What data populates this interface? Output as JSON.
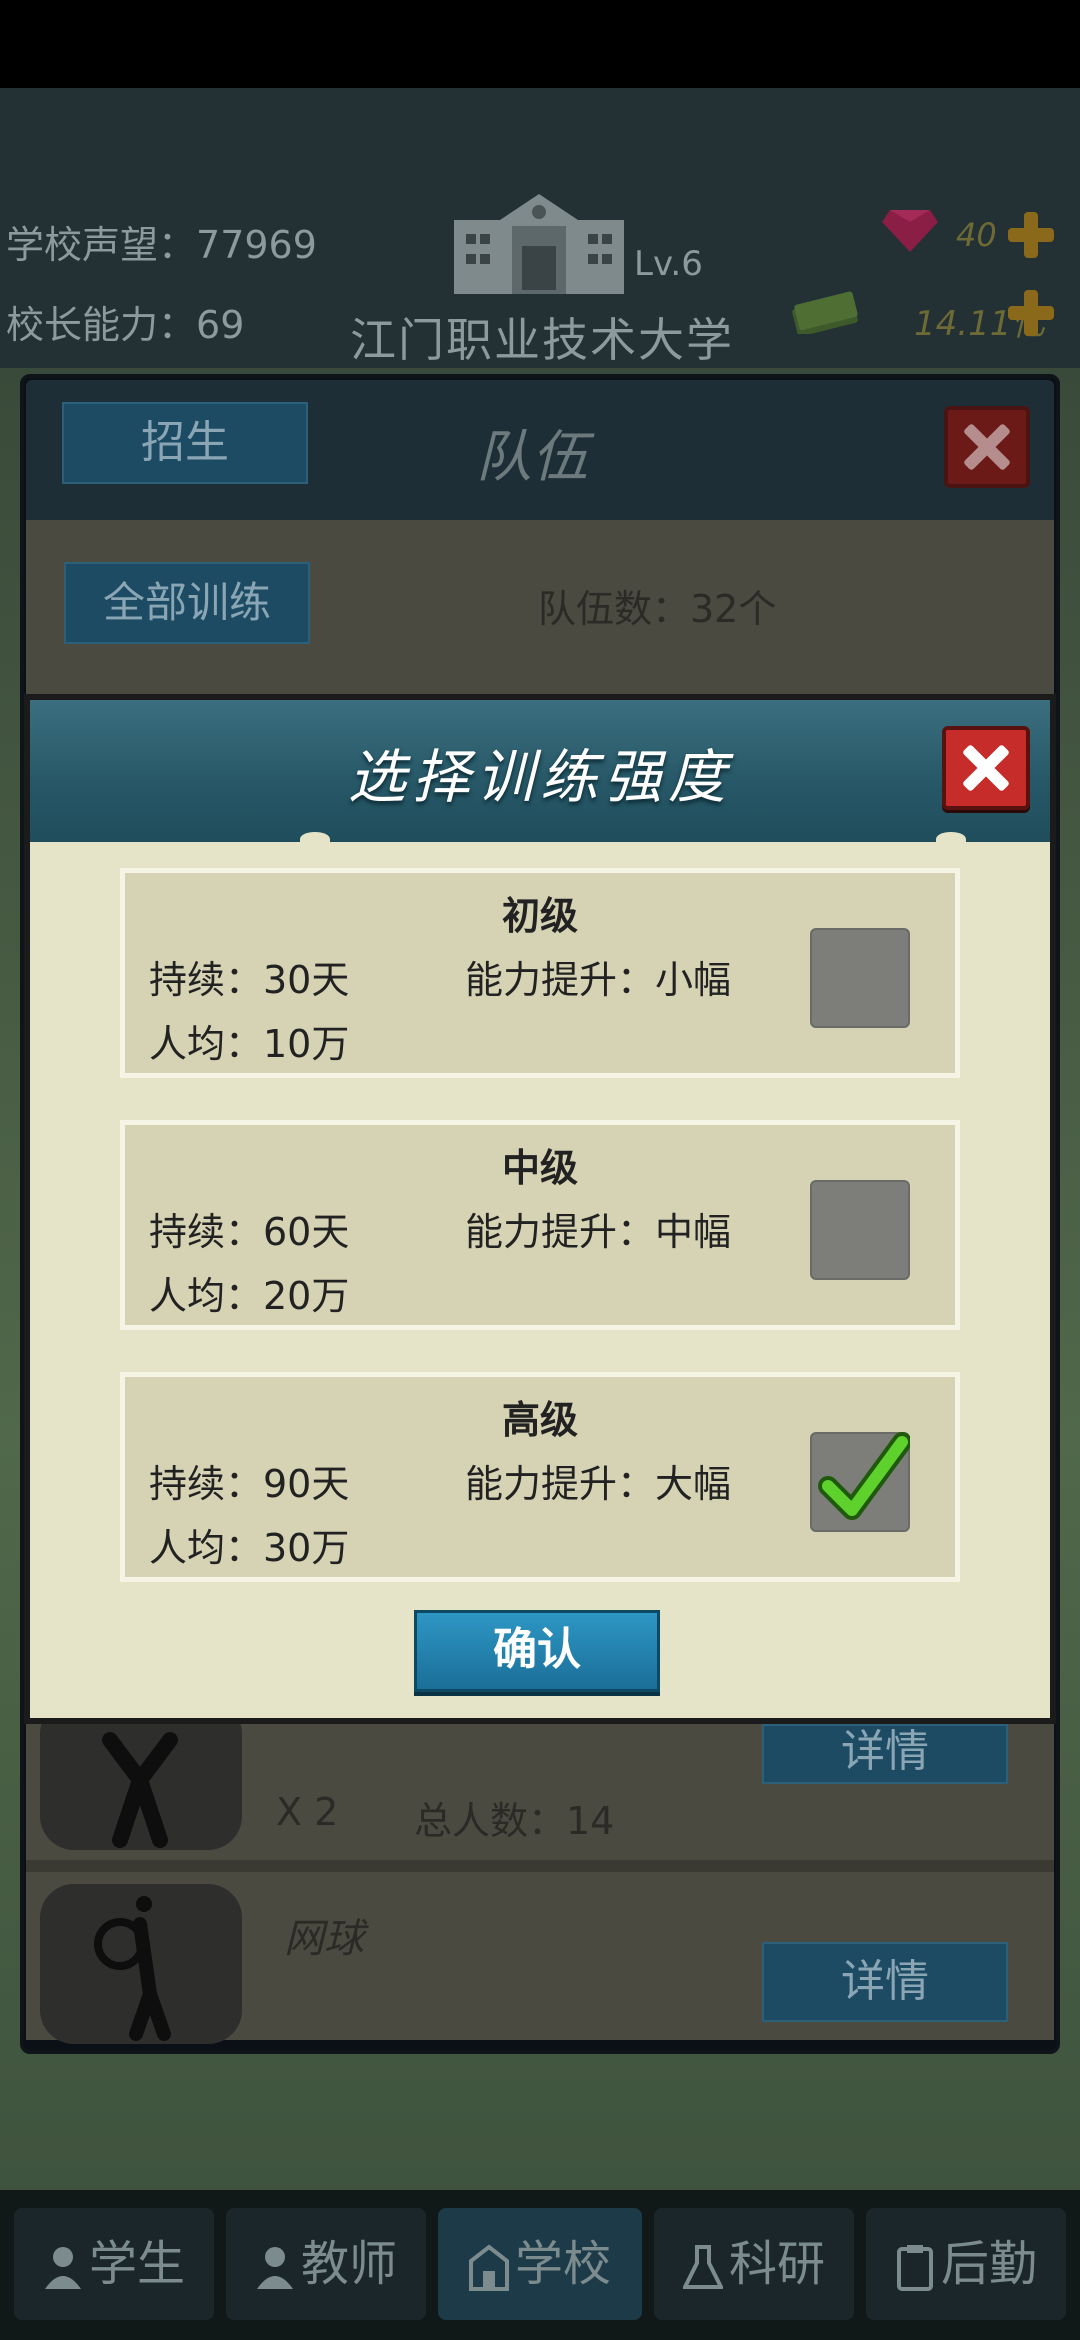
{
  "header": {
    "reputation_label": "学校声望：",
    "reputation_value": "77969",
    "principal_label": "校长能力：",
    "principal_value": "69",
    "school_level": "Lv.6",
    "school_name": "江门职业技术大学",
    "gems": "40",
    "money": "14.11亿"
  },
  "team_panel": {
    "recruit_tab": "招生",
    "title": "队伍",
    "train_all_button": "全部训练",
    "team_count": "队伍数：32个",
    "rows": [
      {
        "count": "X 2",
        "total": "总人数：14",
        "detail": "详情"
      },
      {
        "name": "网球",
        "detail": "详情"
      }
    ]
  },
  "dialog": {
    "title": "选择训练强度",
    "options": [
      {
        "title": "初级",
        "duration": "持续：30天",
        "boost": "能力提升：小幅",
        "cost": "人均：10万",
        "selected": false
      },
      {
        "title": "中级",
        "duration": "持续：60天",
        "boost": "能力提升：中幅",
        "cost": "人均：20万",
        "selected": false
      },
      {
        "title": "高级",
        "duration": "持续：90天",
        "boost": "能力提升：大幅",
        "cost": "人均：30万",
        "selected": true
      }
    ],
    "confirm_button": "确认"
  },
  "bottom_nav": {
    "tabs": [
      {
        "label": "学生",
        "icon": "student-icon"
      },
      {
        "label": "教师",
        "icon": "teacher-icon"
      },
      {
        "label": "学校",
        "icon": "school-icon"
      },
      {
        "label": "科研",
        "icon": "flask-icon"
      },
      {
        "label": "后勤",
        "icon": "clipboard-icon"
      }
    ],
    "active_index": 2
  },
  "colors": {
    "dialog_bg": "#e6e4c8",
    "header_teal": "#285968",
    "close_red": "#c62c29",
    "check_green": "#5fd12c",
    "confirm_blue": "#1a6f98"
  }
}
